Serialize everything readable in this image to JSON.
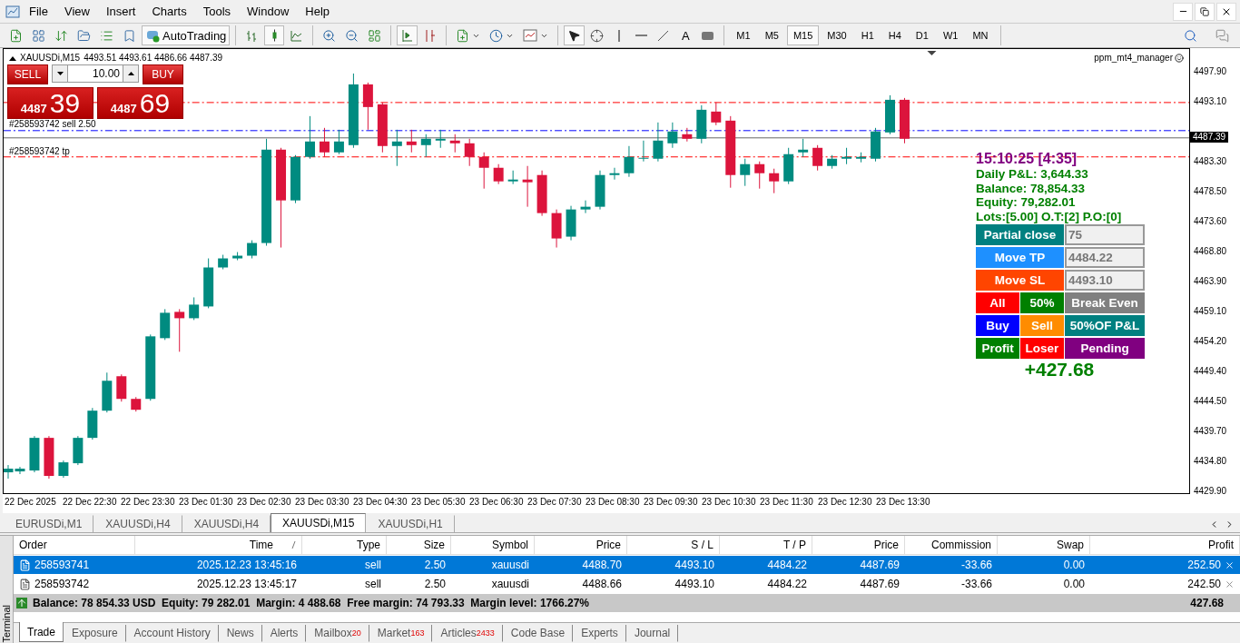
{
  "menu": [
    "File",
    "View",
    "Insert",
    "Charts",
    "Tools",
    "Window",
    "Help"
  ],
  "toolbar": {
    "autotrading": "AutoTrading",
    "text_tool": "A",
    "timeframes": [
      {
        "label": "M1",
        "selected": false
      },
      {
        "label": "M5",
        "selected": false
      },
      {
        "label": "M15",
        "selected": true
      },
      {
        "label": "M30",
        "selected": false
      },
      {
        "label": "H1",
        "selected": false
      },
      {
        "label": "H4",
        "selected": false
      },
      {
        "label": "D1",
        "selected": false
      },
      {
        "label": "W1",
        "selected": false
      },
      {
        "label": "MN",
        "selected": false
      }
    ]
  },
  "chart": {
    "symbol": "XAUUSDi,M15",
    "ohlc": "4493.51 4493.61 4486.66 4487.39",
    "indicator": "ppm_mt4_manager",
    "one_click": {
      "sell": "SELL",
      "buy": "BUY",
      "volume": "10.00",
      "sell_big": "4487",
      "sell_small": "39",
      "buy_big": "4487",
      "buy_small": "69"
    },
    "order_labels": [
      "#258593742 sell 2.50",
      "#258593742 tp"
    ],
    "price_axis": [
      {
        "label": "4497.90",
        "kind": "tick"
      },
      {
        "label": "4493.10",
        "kind": "tick"
      },
      {
        "label": "4487.39",
        "kind": "current"
      },
      {
        "label": "4483.30",
        "kind": "tick"
      },
      {
        "label": "4478.50",
        "kind": "tick"
      },
      {
        "label": "4473.60",
        "kind": "tick"
      },
      {
        "label": "4468.80",
        "kind": "tick"
      },
      {
        "label": "4463.90",
        "kind": "tick"
      },
      {
        "label": "4459.10",
        "kind": "tick"
      },
      {
        "label": "4454.20",
        "kind": "tick"
      },
      {
        "label": "4449.40",
        "kind": "tick"
      },
      {
        "label": "4444.50",
        "kind": "tick"
      },
      {
        "label": "4439.70",
        "kind": "tick"
      },
      {
        "label": "4434.80",
        "kind": "tick"
      },
      {
        "label": "4429.90",
        "kind": "tick"
      }
    ],
    "time_axis": [
      "22 Dec 2025",
      "22 Dec 22:30",
      "22 Dec 23:30",
      "23 Dec 01:30",
      "23 Dec 02:30",
      "23 Dec 03:30",
      "23 Dec 04:30",
      "23 Dec 05:30",
      "23 Dec 06:30",
      "23 Dec 07:30",
      "23 Dec 08:30",
      "23 Dec 09:30",
      "23 Dec 10:30",
      "23 Dec 11:30",
      "23 Dec 12:30",
      "23 Dec 13:30"
    ],
    "manager": {
      "clock": "15:10:25 [4:35]",
      "lines": [
        "Daily P&L: 3,644.33",
        "Balance: 78,854.33",
        "Equity: 79,282.01",
        "Lots:[5.00] O.T:[2] P.O:[0]"
      ],
      "rows": [
        {
          "kind": "field",
          "button": {
            "label": "Partial close",
            "color": "#008080"
          },
          "value": "75"
        },
        {
          "kind": "field",
          "button": {
            "label": "Move TP",
            "color": "#1e90ff"
          },
          "value": "4484.22"
        },
        {
          "kind": "field",
          "button": {
            "label": "Move SL",
            "color": "#ff4500"
          },
          "value": "4493.10"
        },
        {
          "kind": "buttons",
          "buttons": [
            {
              "label": "All",
              "color": "#ff0000"
            },
            {
              "label": "50%",
              "color": "#008000"
            },
            {
              "label": "Break Even",
              "color": "#808080"
            }
          ]
        },
        {
          "kind": "buttons",
          "buttons": [
            {
              "label": "Buy",
              "color": "#0000ff"
            },
            {
              "label": "Sell",
              "color": "#ff8c00"
            },
            {
              "label": "50%OF P&L",
              "color": "#008080"
            }
          ]
        },
        {
          "kind": "buttons",
          "buttons": [
            {
              "label": "Profit",
              "color": "#008000"
            },
            {
              "label": "Loser",
              "color": "#ff0000"
            },
            {
              "label": "Pending",
              "color": "#800080"
            }
          ]
        }
      ],
      "total": "+427.68"
    }
  },
  "chart_tabs": [
    {
      "label": "EURUSDi,M1",
      "selected": false
    },
    {
      "label": "XAUUSDi,H4",
      "selected": false
    },
    {
      "label": "XAUUSDi,H4",
      "selected": false
    },
    {
      "label": "XAUUSDi,M15",
      "selected": true
    },
    {
      "label": "XAUUSDi,H1",
      "selected": false
    }
  ],
  "terminal": {
    "side_label": "Terminal",
    "columns": [
      "Order",
      "Time",
      "Type",
      "Size",
      "Symbol",
      "Price",
      "S / L",
      "T / P",
      "Price",
      "Commission",
      "Swap",
      "Profit"
    ],
    "rows": [
      {
        "selected": true,
        "cells": [
          "258593741",
          "2025.12.23 13:45:16",
          "sell",
          "2.50",
          "xauusdi",
          "4488.70",
          "4493.10",
          "4484.22",
          "4487.69",
          "-33.66",
          "0.00",
          "252.50"
        ]
      },
      {
        "selected": false,
        "cells": [
          "258593742",
          "2025.12.23 13:45:17",
          "sell",
          "2.50",
          "xauusdi",
          "4488.66",
          "4493.10",
          "4484.22",
          "4487.69",
          "-33.66",
          "0.00",
          "242.50"
        ]
      }
    ],
    "summary": {
      "text": "Balance: 78 854.33 USD  Equity: 79 282.01  Margin: 4 488.68  Free margin: 74 793.33  Margin level: 1766.27%",
      "profit": "427.68"
    },
    "tabs": [
      {
        "label": "Trade",
        "selected": true
      },
      {
        "label": "Exposure",
        "selected": false
      },
      {
        "label": "Account History",
        "selected": false
      },
      {
        "label": "News",
        "selected": false
      },
      {
        "label": "Alerts",
        "selected": false
      },
      {
        "label": "Mailbox",
        "badge": "20",
        "selected": false
      },
      {
        "label": "Market",
        "badge": "163",
        "selected": false
      },
      {
        "label": "Articles",
        "badge": "2433",
        "selected": false
      },
      {
        "label": "Code Base",
        "selected": false
      },
      {
        "label": "Experts",
        "selected": false
      },
      {
        "label": "Journal",
        "selected": false
      }
    ]
  }
}
